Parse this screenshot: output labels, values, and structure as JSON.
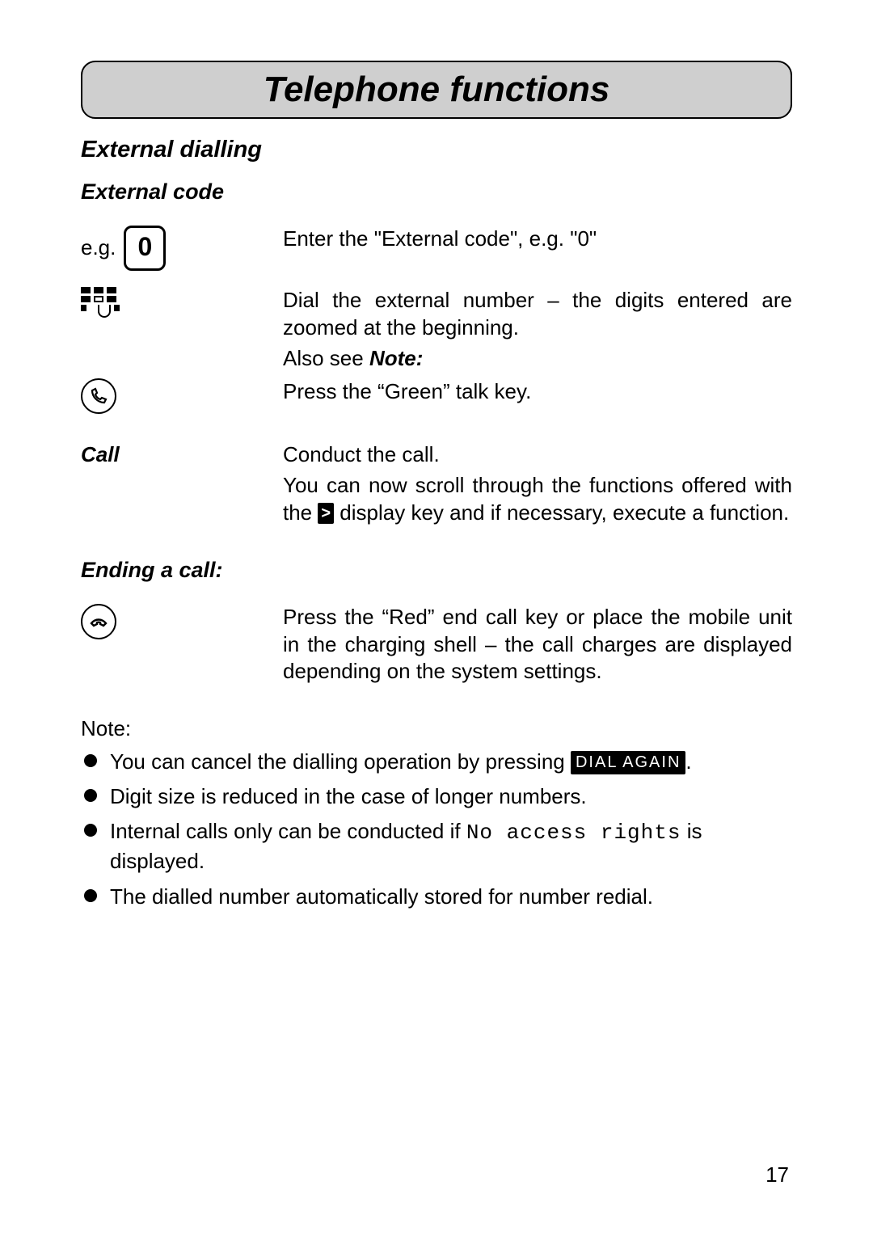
{
  "title": "Telephone functions",
  "section": "External dialling",
  "subsection": "External code",
  "row_eg": {
    "left_prefix": "e.g.",
    "key_label": "0",
    "right": "Enter the \"External code\", e.g. \"0\""
  },
  "row_dial": {
    "line1": "Dial the external number – the digits entered are zoomed at the beginning.",
    "line2_a": "Also see ",
    "line2_b": "Note:"
  },
  "row_talk": {
    "right": "Press the “Green” talk key."
  },
  "row_call": {
    "left": "Call",
    "line1": "Conduct the call.",
    "line2_a": "You can now scroll through the functions offered with the ",
    "chip": ">",
    "line2_b": " display key and if necessary, execute a function."
  },
  "ending_heading": "Ending a call:",
  "row_end": {
    "right": "Press the “Red” end call key or place the mobile unit in the charging shell – the call charges are displayed depending on the system settings."
  },
  "note_label": "Note:",
  "notes": {
    "n1_a": "You can cancel the dialling operation by pressing ",
    "n1_chip": "DIAL AGAIN",
    "n1_b": ".",
    "n2": "Digit size is reduced in the case of longer numbers.",
    "n3_a": "Internal calls only can be conducted if ",
    "n3_code": "No access rights",
    "n3_b": " is displayed.",
    "n4": "The dialled number automatically stored for number redial."
  },
  "page_number": "17"
}
